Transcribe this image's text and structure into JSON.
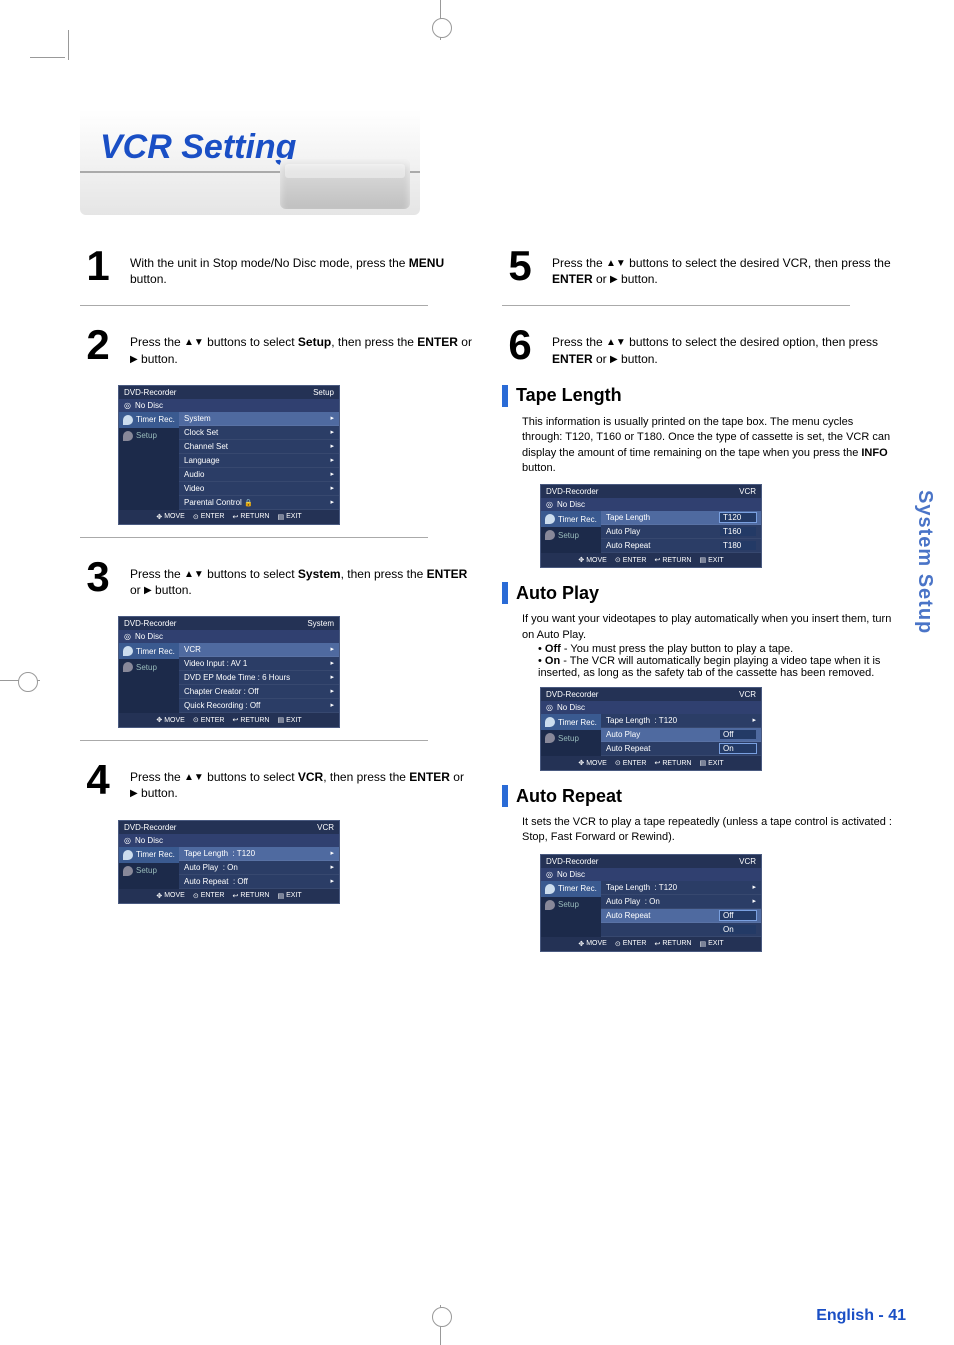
{
  "title": "VCR Setting",
  "side_tab": "System Setup",
  "page_number": "- 41",
  "steps_left": {
    "s1": {
      "num": "1",
      "text_a": "With the unit in Stop mode/No Disc mode, press the ",
      "b1": "MENU",
      "text_b": " button."
    },
    "s2": {
      "num": "2",
      "text_a": "Press the ",
      "tri": "▲▼",
      "text_b": " buttons to select ",
      "b1": "Setup",
      "text_c": ", then press the ",
      "b2": "ENTER",
      "text_d": " or ",
      "play": "▶",
      "text_e": " button."
    },
    "s3": {
      "num": "3",
      "text_a": "Press the ",
      "tri": "▲▼",
      "text_b": " buttons to select ",
      "b1": "System",
      "text_c": ", then press the ",
      "b2": "ENTER",
      "text_d": " or ",
      "play": "▶",
      "text_e": " button."
    },
    "s4": {
      "num": "4",
      "text_a": "Press the ",
      "tri": "▲▼",
      "text_b": " buttons to select ",
      "b1": "VCR",
      "text_c": ", then press the ",
      "b2": "ENTER",
      "text_d": " or ",
      "play": "▶",
      "text_e": " button."
    }
  },
  "steps_right": {
    "s5": {
      "num": "5",
      "text_a": "Press the ",
      "tri": "▲▼",
      "text_b": " buttons to select the desired VCR, then press the ",
      "b1": "ENTER",
      "text_c": " or ",
      "play": "▶",
      "text_d": " button."
    },
    "s6": {
      "num": "6",
      "text_a": "Press the ",
      "tri": "▲▼",
      "text_b": " buttons to select the desired option, then press ",
      "b1": "ENTER",
      "text_c": " or ",
      "play": "▶",
      "text_d": " button."
    }
  },
  "sections": {
    "tape": {
      "title": "Tape Length",
      "body_a": "This information is usually printed on the tape box. The menu cycles through: T120, T160 or T180. Once the type of cassette is set, the VCR can display the amount of time remaining on the tape when you press the ",
      "b1": "INFO",
      "body_b": " button."
    },
    "autoplay": {
      "title": "Auto Play",
      "body_a": "If you want your videotapes to play automatically when you insert them, turn on Auto Play.",
      "off_lbl": "Off",
      "off_txt": " - You must press the play button to play a tape.",
      "on_lbl": "On",
      "on_txt": " - The VCR will automatically begin playing a video tape when it is inserted, as long as the safety tab of the cassette has been removed."
    },
    "autorep": {
      "title": "Auto Repeat",
      "body": "It sets the VCR to play a tape repeatedly (unless a tape control is activated : Stop, Fast Forward or Rewind)."
    }
  },
  "osd": {
    "brand": "DVD-Recorder",
    "nodisc": "No Disc",
    "side_timer": "Timer Rec.",
    "side_setup": "Setup",
    "footer_move": "MOVE",
    "footer_enter": "ENTER",
    "footer_return": "RETURN",
    "footer_exit": "EXIT",
    "setup_tag": "Setup",
    "system_tag": "System",
    "vcr_tag": "VCR",
    "setup_menu": [
      "System",
      "Clock Set",
      "Channel Set",
      "Language",
      "Audio",
      "Video",
      "Parental Control"
    ],
    "system_menu": [
      {
        "l": "VCR",
        "r": ""
      },
      {
        "l": "Video Input",
        "r": ": AV 1"
      },
      {
        "l": "DVD EP Mode Time",
        "r": ": 6 Hours"
      },
      {
        "l": "Chapter Creator",
        "r": ": Off"
      },
      {
        "l": "Quick Recording",
        "r": ": Off"
      }
    ],
    "vcr_menu": [
      {
        "l": "Tape Length",
        "r": ": T120"
      },
      {
        "l": "Auto Play",
        "r": ": On"
      },
      {
        "l": "Auto Repeat",
        "r": ": Off"
      }
    ],
    "tape_opts": [
      "T120",
      "T160",
      "T180"
    ],
    "autoplay_opts": [
      "Off",
      "On"
    ],
    "autorep_opts": [
      "Off",
      "On"
    ],
    "tape_val": ": T120",
    "on_val": ": On"
  }
}
